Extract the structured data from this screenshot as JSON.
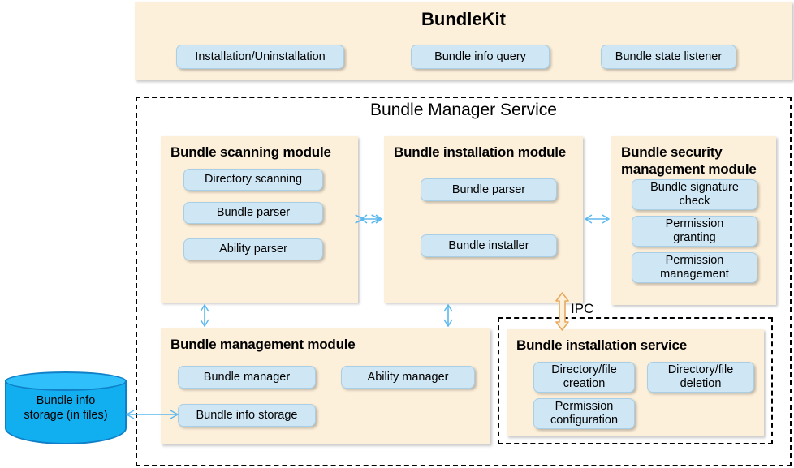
{
  "header": {
    "title": "BundleKit",
    "chips": [
      {
        "label": "Installation/Uninstallation"
      },
      {
        "label": "Bundle info query"
      },
      {
        "label": "Bundle state listener"
      }
    ]
  },
  "service": {
    "title": "Bundle Manager Service"
  },
  "modules": {
    "scanning": {
      "title": "Bundle scanning module",
      "chips": [
        {
          "label": "Directory scanning"
        },
        {
          "label": "Bundle parser"
        },
        {
          "label": "Ability parser"
        }
      ]
    },
    "installation": {
      "title": "Bundle installation module",
      "chips": [
        {
          "label": "Bundle parser"
        },
        {
          "label": "Bundle installer"
        }
      ]
    },
    "security": {
      "title": "Bundle security\nmanagement module",
      "chips": [
        {
          "label": "Bundle signature\ncheck"
        },
        {
          "label": "Permission\ngranting"
        },
        {
          "label": "Permission\nmanagement"
        }
      ]
    },
    "management": {
      "title": "Bundle management module",
      "chips": [
        {
          "label": "Bundle manager"
        },
        {
          "label": "Ability manager"
        },
        {
          "label": "Bundle info storage"
        }
      ]
    },
    "install_service": {
      "title": "Bundle installation service",
      "chips": [
        {
          "label": "Directory/file\ncreation"
        },
        {
          "label": "Directory/file\ndeletion"
        },
        {
          "label": "Permission\nconfiguration"
        }
      ]
    }
  },
  "storage": {
    "label": "Bundle info\nstorage (in files)"
  },
  "connectors": {
    "ipc_label": "IPC"
  },
  "colors": {
    "panel_fill": "#fdf0da",
    "chip_fill": "#cfe6f4",
    "chip_border": "#a9cfe6",
    "arrow_blue": "#5bb8ef",
    "arrow_orange": "#e8a95e",
    "cylinder_fill": "#12aff0",
    "cylinder_top": "#2fc0fb",
    "cylinder_border": "#0f7fc7",
    "dashed_border": "#000000"
  }
}
